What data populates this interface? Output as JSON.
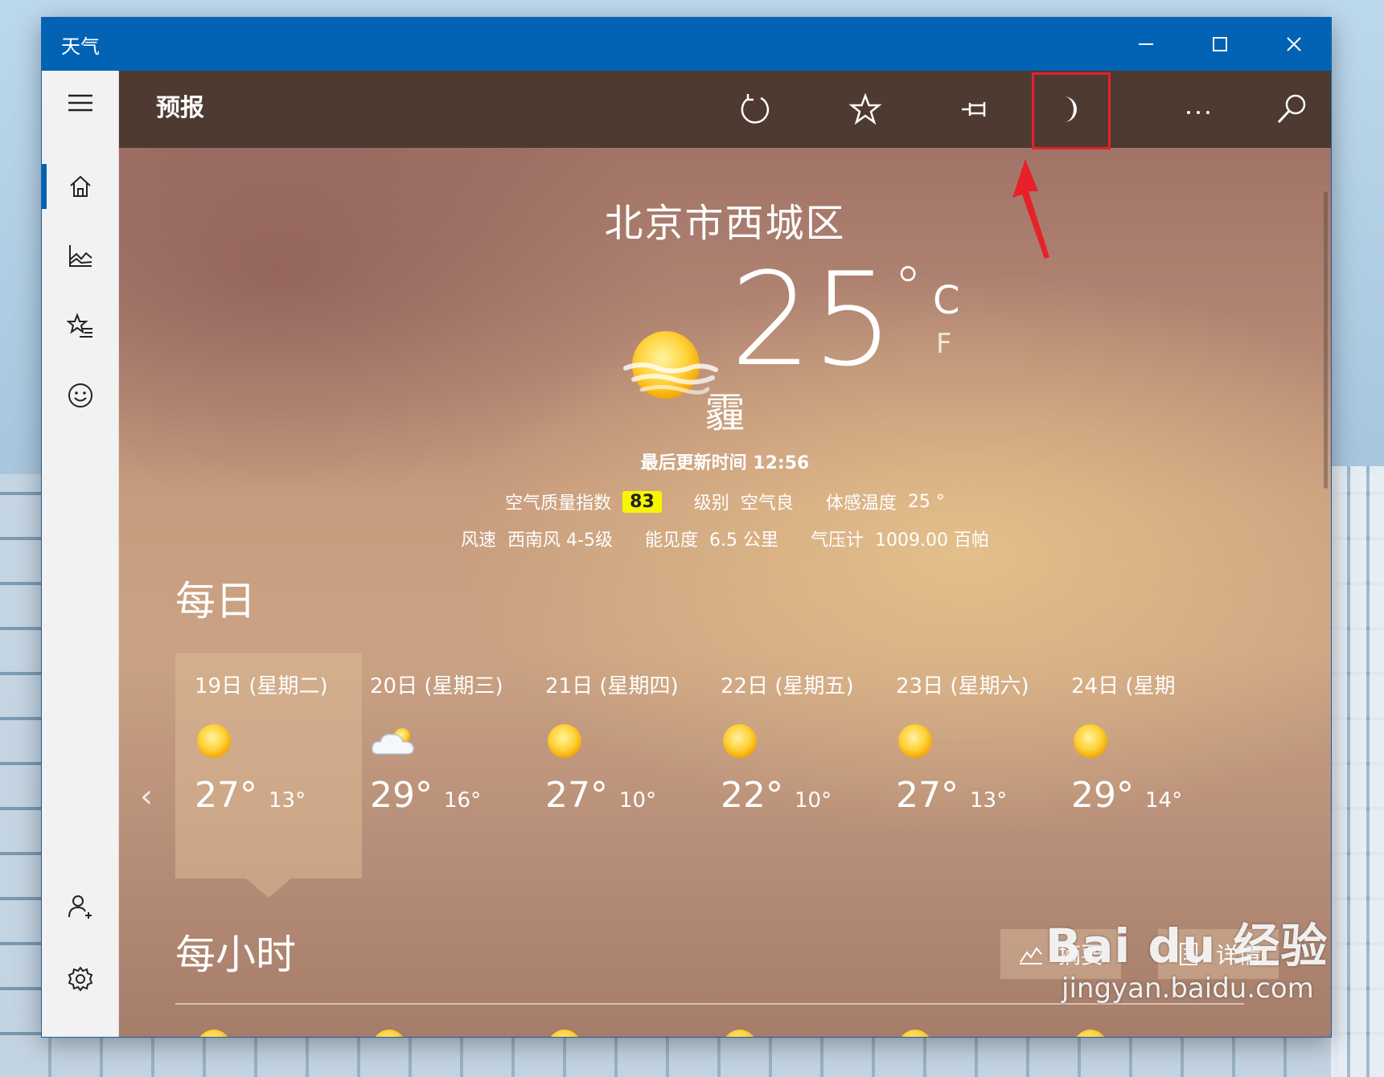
{
  "window": {
    "title": "天气"
  },
  "appbar": {
    "section_title": "预报"
  },
  "location": {
    "name": "北京市西城区"
  },
  "current": {
    "temperature": "25",
    "degree_symbol": "°",
    "unit_c": "C",
    "unit_f": "F",
    "condition": "霾",
    "updated": "最后更新时间 12:56"
  },
  "metrics": {
    "aqi_label": "空气质量指数",
    "aqi_value": "83",
    "level_label": "级别",
    "level_value": "空气良",
    "feels_label": "体感温度",
    "feels_value": "25 °",
    "wind_label": "风速",
    "wind_value": "西南风 4-5级",
    "visibility_label": "能见度",
    "visibility_value": "6.5 公里",
    "pressure_label": "气压计",
    "pressure_value": "1009.00 百帕"
  },
  "daily": {
    "heading": "每日",
    "days": [
      {
        "label": "19日 (星期二)",
        "hi": "27°",
        "lo": "13°",
        "icon": "sun-icon"
      },
      {
        "label": "20日 (星期三)",
        "hi": "29°",
        "lo": "16°",
        "icon": "cloud-icon"
      },
      {
        "label": "21日 (星期四)",
        "hi": "27°",
        "lo": "10°",
        "icon": "sun-icon"
      },
      {
        "label": "22日 (星期五)",
        "hi": "22°",
        "lo": "10°",
        "icon": "sun-icon"
      },
      {
        "label": "23日 (星期六)",
        "hi": "27°",
        "lo": "13°",
        "icon": "sun-icon"
      },
      {
        "label": "24日 (星期",
        "hi": "29°",
        "lo": "14°",
        "icon": "sun-icon"
      }
    ],
    "prev_arrow": "‹",
    "next_arrow": "›"
  },
  "hourly": {
    "heading": "每小时",
    "summary_label": "摘要",
    "details_label": "详情"
  },
  "watermark": {
    "line1": "Bai du 经验",
    "line2": "jingyan.baidu.com"
  },
  "colors": {
    "titlebar": "#0263b4",
    "appbar": "#4e3a30",
    "aqi_badge": "#f7f500",
    "annotation": "#e8202a"
  }
}
